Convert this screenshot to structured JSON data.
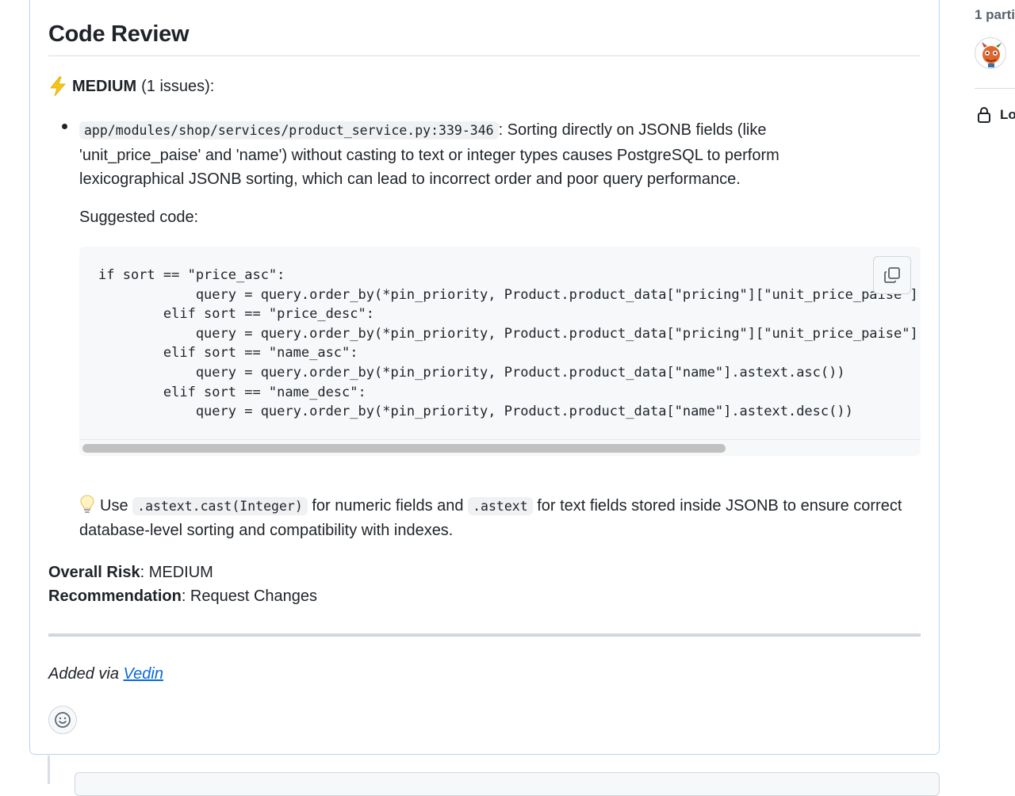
{
  "comment": {
    "title": "Code Review",
    "severity": {
      "level": "MEDIUM",
      "count_text": "(1 issues):"
    },
    "issue": {
      "file_ref": "app/modules/shop/services/product_service.py:339-346",
      "description": ": Sorting directly on JSONB fields (like 'unit_price_paise' and 'name') without casting to text or integer types causes PostgreSQL to perform lexicographical JSONB sorting, which can lead to incorrect order and poor query performance.",
      "suggested_label": "Suggested code:",
      "code_lines": [
        "if sort == \"price_asc\":",
        "            query = query.order_by(*pin_priority, Product.product_data[\"pricing\"][\"unit_price_paise\"].astext.cast(Integer).asc())",
        "        elif sort == \"price_desc\":",
        "            query = query.order_by(*pin_priority, Product.product_data[\"pricing\"][\"unit_price_paise\"].astext.cast(Integer).desc())",
        "        elif sort == \"name_asc\":",
        "            query = query.order_by(*pin_priority, Product.product_data[\"name\"].astext.asc())",
        "        elif sort == \"name_desc\":",
        "            query = query.order_by(*pin_priority, Product.product_data[\"name\"].astext.desc())"
      ],
      "code_scroll_fraction": 0.77
    },
    "tip": {
      "use_word": "Use",
      "code1": ".astext.cast(Integer)",
      "middle": "for numeric fields and",
      "code2": ".astext",
      "rest": "for text fields stored inside JSONB to ensure correct database-level sorting and compatibility with indexes."
    },
    "overall_risk": {
      "label": "Overall Risk",
      "value": ": MEDIUM"
    },
    "recommendation": {
      "label": "Recommendation",
      "value": ": Request Changes"
    },
    "added_via": {
      "prefix": "Added via",
      "link": "Vedin"
    }
  },
  "sidebar": {
    "participants_label": "1 parti",
    "lock_label": "Lo"
  },
  "colors": {
    "link": "#0969da",
    "card_border": "#b6d4f3",
    "code_bg": "#f6f8fa",
    "bolt": "#f5c518"
  },
  "icons": [
    "bolt-icon",
    "copy-icon",
    "lightbulb-icon",
    "smiley-icon",
    "lock-icon",
    "avatar-image"
  ]
}
